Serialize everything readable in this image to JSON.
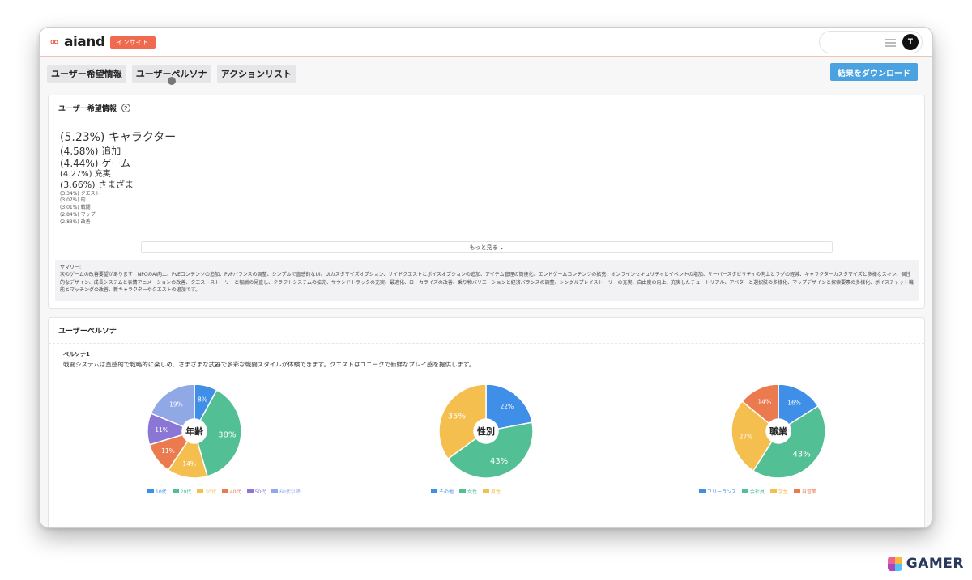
{
  "app": {
    "logo_text": "aiand",
    "badge": "インサイト",
    "avatar_initial": "T"
  },
  "tabs": [
    {
      "label": "ユーザー希望情報"
    },
    {
      "label": "ユーザーペルソナ"
    },
    {
      "label": "アクションリスト"
    }
  ],
  "download_label": "結果をダウンロード",
  "wishes": {
    "title": "ユーザー希望情報",
    "help": "?",
    "words": [
      {
        "text": "(5.23%) キャラクター"
      },
      {
        "text": "(4.58%) 追加"
      },
      {
        "text": "(4.44%) ゲーム"
      },
      {
        "text": "(4.27%) 充実"
      },
      {
        "text": "(3.66%) さまざま"
      },
      {
        "text": "(3.34%) クエスト"
      },
      {
        "text": "(3.07%) 的"
      },
      {
        "text": "(3.01%) 戦闘"
      },
      {
        "text": "(2.84%) マップ"
      },
      {
        "text": "(2.83%) 改善"
      }
    ],
    "more_label": "もっと見る ⌄",
    "summary_label": "サマリー:",
    "summary_text": "次のゲームの改善要望があります：NPCのAI向上、PvEコンテンツの追加、PvPバランスの調整、シンプルで直感的なUI、UIカスタマイズオプション、サイドクエストとボイスオプションの追加、アイテム管理の簡便化、エンドゲームコンテンツの拡充、オンラインセキュリティとイベントの増加、サーバースタビリティの向上とラグの軽減、キャラクターカスタマイズと多様なスキン、個性的なデザイン、成長システムと表情アニメーションの改善、クエストストーリーと報酬の見直し、クラフトシステムの拡充、サウンドトラックの充実、最適化、ローカライズの改善、乗り物バリエーションと経済バランスの調整、シングルプレイストーリーの充実、自由度の向上、充実したチュートリアル、アバターと選択肢の多様化、マップデザインと探索要素の多様化、ボイスチャット機能とマッチングの改善、新キャラクターやクエストの追加です。"
  },
  "persona": {
    "title": "ユーザーペルソナ",
    "name": "ペルソナ1",
    "description": "戦闘システムは直感的で戦略的に楽しめ、さまざまな武器で多彩な戦闘スタイルが体験できます。クエストはユニークで新鮮なプレイ感を提供します。"
  },
  "chart_data": [
    {
      "type": "pie",
      "title": "年齢",
      "categories": [
        "10代",
        "20代",
        "30代",
        "40代",
        "50代",
        "60代以降"
      ],
      "values": [
        8,
        38,
        14,
        11,
        11,
        19
      ],
      "labels": [
        "8%",
        "38%",
        "14%",
        "11%",
        "11%",
        "19%"
      ],
      "colors": [
        "#3f8ee8",
        "#52bf94",
        "#f5bf4f",
        "#ec7a4f",
        "#8b76d6",
        "#90a8e6"
      ],
      "legend": "bottom"
    },
    {
      "type": "pie",
      "title": "性別",
      "categories": [
        "その他",
        "女性",
        "男性"
      ],
      "values": [
        22,
        43,
        35
      ],
      "labels": [
        "22%",
        "43%",
        "35%"
      ],
      "colors": [
        "#3f8ee8",
        "#52bf94",
        "#f5bf4f"
      ],
      "legend": "bottom"
    },
    {
      "type": "pie",
      "title": "職業",
      "categories": [
        "フリーランス",
        "会社員",
        "学生",
        "自営業"
      ],
      "values": [
        16,
        43,
        27,
        14
      ],
      "labels": [
        "16%",
        "43%",
        "27%",
        "14%"
      ],
      "colors": [
        "#3f8ee8",
        "#52bf94",
        "#f5bf4f",
        "#ec7a4f"
      ],
      "legend": "bottom"
    }
  ],
  "watermark": "GAMER"
}
